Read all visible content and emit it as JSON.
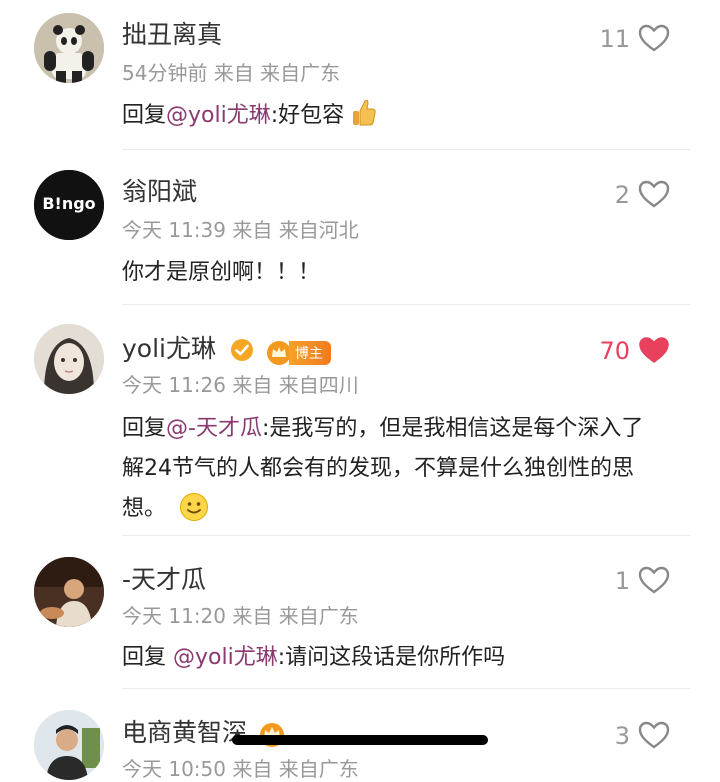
{
  "comments": [
    {
      "name": "拙丑离真",
      "meta": "54分钟前 来自 来自广东",
      "reply_prefix": "回复",
      "mention": "@yoli尤琳",
      "text": ":好包容",
      "emoji": "thumbs-up",
      "likes": "11",
      "liked": false
    },
    {
      "name": "翁阳斌",
      "avatar_text": "B!ngo",
      "meta": "今天 11:39 来自 来自河北",
      "text": "你才是原创啊！！！",
      "likes": "2",
      "liked": false
    },
    {
      "name": "yoli尤琳",
      "badge_label": "博主",
      "meta": "今天 11:26 来自 来自四川",
      "reply_prefix": "回复",
      "mention": "@-天才瓜",
      "line1": ":是我写的，但是我相信这是每个深入了",
      "line2": "解24节气的人都会有的发现，不算是什么独创性的思",
      "line3": "想。",
      "emoji": "smile",
      "likes": "70",
      "liked": true
    },
    {
      "name": "-天才瓜",
      "meta": "今天 11:20 来自 来自广东",
      "reply_prefix": "回复 ",
      "mention": "@yoli尤琳",
      "text": ":请问这段话是你所作吗",
      "likes": "1",
      "liked": false
    },
    {
      "name": "电商黄智深",
      "meta": "今天 10:50 来自 来自广东",
      "likes": "3",
      "liked": false
    }
  ],
  "colors": {
    "accent_red": "#e8405d",
    "mention": "#8a3a6f",
    "meta_gray": "#999999"
  }
}
